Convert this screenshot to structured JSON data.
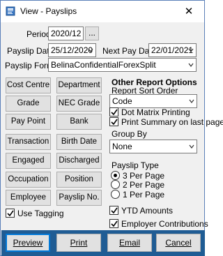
{
  "window": {
    "title": "View - Payslips",
    "app_icon": "payslip-app-icon",
    "close_label": "✕"
  },
  "form": {
    "period_label": "Period",
    "period_value": "2020/12",
    "period_lookup_label": "...",
    "payslip_date_label": "Payslip Date",
    "payslip_date_value": "25/12/2020",
    "next_pay_date_label": "Next Pay Date",
    "next_pay_date_value": "22/01/2021",
    "payslip_format_label": "Payslip Format",
    "payslip_format_value": "BelinaConfidentialForexSplit"
  },
  "sort_buttons": [
    {
      "label": "Cost Centre"
    },
    {
      "label": "Department"
    },
    {
      "label": "Grade"
    },
    {
      "label": "NEC Grade"
    },
    {
      "label": "Pay Point"
    },
    {
      "label": "Bank"
    },
    {
      "label": "Transaction"
    },
    {
      "label": "Birth Date"
    },
    {
      "label": "Engaged"
    },
    {
      "label": "Discharged"
    },
    {
      "label": "Occupation"
    },
    {
      "label": "Position"
    },
    {
      "label": "Employee"
    },
    {
      "label": "Payslip No."
    }
  ],
  "use_tagging": {
    "label": "Use Tagging",
    "checked": true
  },
  "report_options": {
    "heading": "Other Report Options",
    "sort_order_label": "Report Sort Order",
    "sort_order_value": "Code",
    "dot_matrix_label": "Dot Matrix Printing",
    "dot_matrix_checked": true,
    "print_summary_label": "Print Summary on last page",
    "print_summary_checked": true,
    "group_by_label": "Group By",
    "group_by_value": "None",
    "payslip_type_label": "Payslip Type",
    "payslip_types": [
      {
        "label": "3 Per Page",
        "selected": true
      },
      {
        "label": "2 Per Page",
        "selected": false
      },
      {
        "label": "1 Per Page",
        "selected": false
      }
    ],
    "ytd_label": "YTD Amounts",
    "ytd_checked": true,
    "employer_contrib_label": "Employer Contributions",
    "employer_contrib_checked": true
  },
  "actions": {
    "preview_label": "Preview",
    "print_label": "Print",
    "email_label": "Email",
    "cancel_label": "Cancel"
  },
  "colors": {
    "bottom_bar": "#1f5c94",
    "accent": "#0078d7"
  }
}
